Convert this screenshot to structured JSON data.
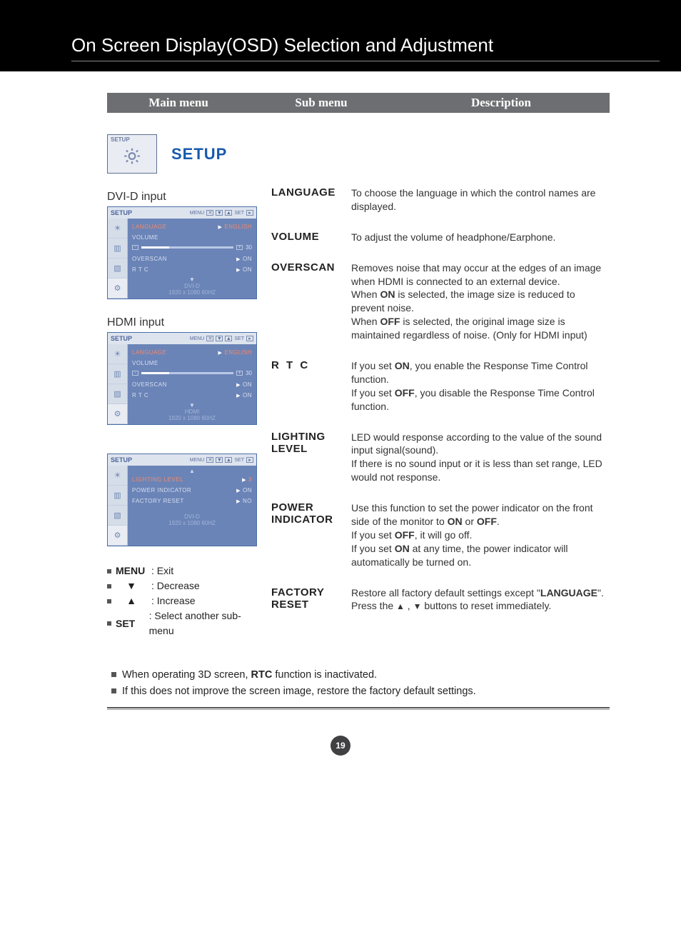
{
  "header": {
    "title": "On Screen Display(OSD) Selection and Adjustment"
  },
  "columns": {
    "c1": "Main menu",
    "c2": "Sub menu",
    "c3": "Description"
  },
  "setup": {
    "icon_label": "SETUP",
    "title": "SETUP"
  },
  "inputs": {
    "dvid": "DVI-D input",
    "hdmi": "HDMI input"
  },
  "osd_dvid": {
    "title": "SETUP",
    "hdr_menu": "MENU",
    "hdr_set": "SET",
    "language_label": "LANGUAGE",
    "language_value": "ENGLISH",
    "volume_label": "VOLUME",
    "volume_value": "30",
    "overscan_label": "OVERSCAN",
    "overscan_value": "ON",
    "rtc_label": "R T C",
    "rtc_value": "ON",
    "footer_source": "DVI-D",
    "footer_res": "1920 x 1080    60HZ"
  },
  "osd_hdmi": {
    "title": "SETUP",
    "language_label": "LANGUAGE",
    "language_value": "ENGLISH",
    "volume_label": "VOLUME",
    "volume_value": "30",
    "overscan_label": "OVERSCAN",
    "overscan_value": "ON",
    "rtc_label": "R T C",
    "rtc_value": "ON",
    "footer_source": "HDMI",
    "footer_res": "1920 x 1080    60HZ"
  },
  "osd_page2": {
    "title": "SETUP",
    "lighting_label": "LIGHTING LEVEL",
    "lighting_value": "3",
    "power_label": "POWER  INDICATOR",
    "power_value": "ON",
    "factory_label": "FACTORY  RESET",
    "factory_value": "NO",
    "footer_source": "DVI-D",
    "footer_res": "1920 x 1080    60HZ"
  },
  "desc": {
    "language": {
      "name": "LANGUAGE",
      "text": "To choose the language in which the control names are displayed."
    },
    "volume": {
      "name": "VOLUME",
      "text": "To adjust the volume of headphone/Earphone."
    },
    "overscan": {
      "name": "OVERSCAN",
      "p1": "Removes noise that may occur at the edges of an image when HDMI is connected to an external device.",
      "p2a": "When ",
      "p2b": "ON",
      "p2c": " is selected, the image size is reduced to prevent noise.",
      "p3a": "When ",
      "p3b": "OFF",
      "p3c": " is selected, the original image size is maintained regardless of noise. (Only for HDMI input)"
    },
    "rtc": {
      "name": "R T C",
      "p1a": "If you set ",
      "p1b": "ON",
      "p1c": ", you enable the Response Time Control function.",
      "p2a": "If you set ",
      "p2b": "OFF",
      "p2c": ", you disable the Response Time Control function."
    },
    "lighting": {
      "name": "LIGHTING LEVEL",
      "p1": "LED would response according to the value of the sound input signal(sound).",
      "p2": "If there is no sound input or it is less than set range, LED would not response."
    },
    "power": {
      "name": "POWER INDICATOR",
      "p1a": "Use this function to set the power indicator on the front side of the monitor to ",
      "p1b": "ON",
      "p1c": " or ",
      "p1d": "OFF",
      "p1e": ".",
      "p2a": "If you set ",
      "p2b": "OFF",
      "p2c": ", it will go off.",
      "p3a": "If you set ",
      "p3b": "ON",
      "p3c": " at any time, the power indicator will automatically be turned on."
    },
    "factory": {
      "name": "FACTORY RESET",
      "p1a": "Restore all factory default settings except \"",
      "p1b": "LANGUAGE",
      "p1c": "\".",
      "p2a": "Press the ",
      "p2b": " , ",
      "p2c": " buttons to reset immediately."
    }
  },
  "legend": {
    "menu_key": "MENU",
    "menu_txt": ": Exit",
    "dec_txt": ": Decrease",
    "inc_txt": ": Increase",
    "set_key": "SET",
    "set_txt": ": Select another sub-menu"
  },
  "notes": {
    "n1a": "When operating 3D screen, ",
    "n1b": "RTC",
    "n1c": " function is inactivated.",
    "n2": "If this does not improve the screen image, restore the factory default settings."
  },
  "page_number": "19"
}
